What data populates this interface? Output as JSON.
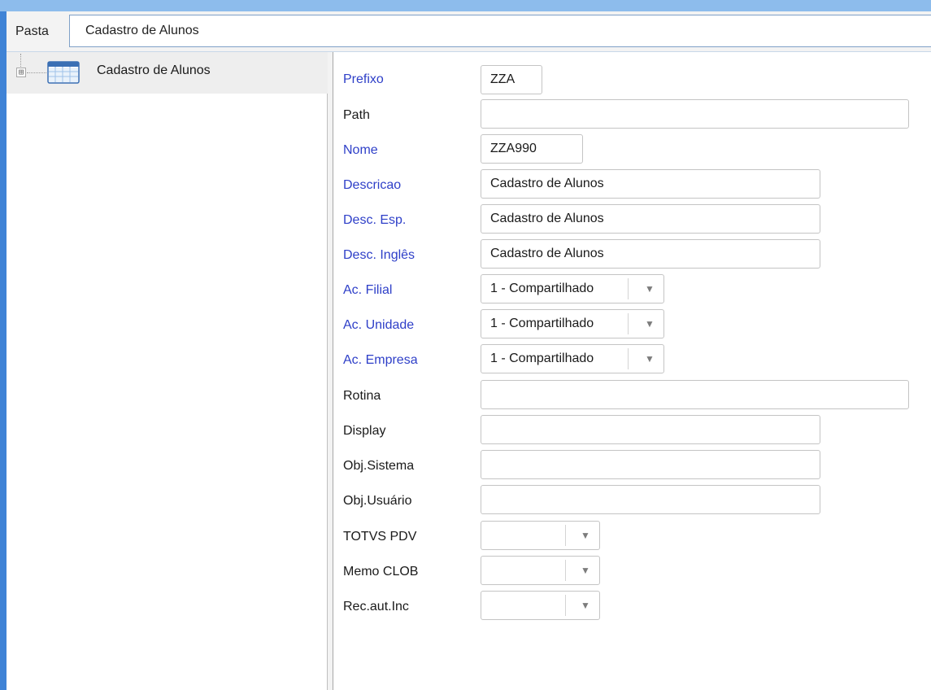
{
  "pasta": {
    "label": "Pasta",
    "value": "Cadastro de Alunos"
  },
  "tree": {
    "items": [
      {
        "label": "Cadastro de Alunos",
        "icon": "table-icon",
        "expander": "⊞"
      }
    ]
  },
  "form": {
    "required_color": "#2e3fc8",
    "fields": {
      "prefixo": {
        "label": "Prefixo",
        "value": "ZZA"
      },
      "path": {
        "label": "Path",
        "value": ""
      },
      "nome": {
        "label": "Nome",
        "value": "ZZA990"
      },
      "descricao": {
        "label": "Descricao",
        "value": "Cadastro de Alunos"
      },
      "desc_esp": {
        "label": "Desc. Esp.",
        "value": "Cadastro de Alunos"
      },
      "desc_ingles": {
        "label": "Desc. Inglês",
        "value": "Cadastro de Alunos"
      },
      "ac_filial": {
        "label": "Ac. Filial",
        "value": "1 - Compartilhado"
      },
      "ac_unidade": {
        "label": "Ac. Unidade",
        "value": "1 - Compartilhado"
      },
      "ac_empresa": {
        "label": "Ac. Empresa",
        "value": "1 - Compartilhado"
      },
      "rotina": {
        "label": "Rotina",
        "value": ""
      },
      "display": {
        "label": "Display",
        "value": ""
      },
      "obj_sistema": {
        "label": "Obj.Sistema",
        "value": ""
      },
      "obj_usuario": {
        "label": "Obj.Usuário",
        "value": ""
      },
      "totvs_pdv": {
        "label": "TOTVS PDV",
        "value": ""
      },
      "memo_clob": {
        "label": "Memo CLOB",
        "value": ""
      },
      "rec_aut_inc": {
        "label": "Rec.aut.Inc",
        "value": ""
      }
    }
  }
}
